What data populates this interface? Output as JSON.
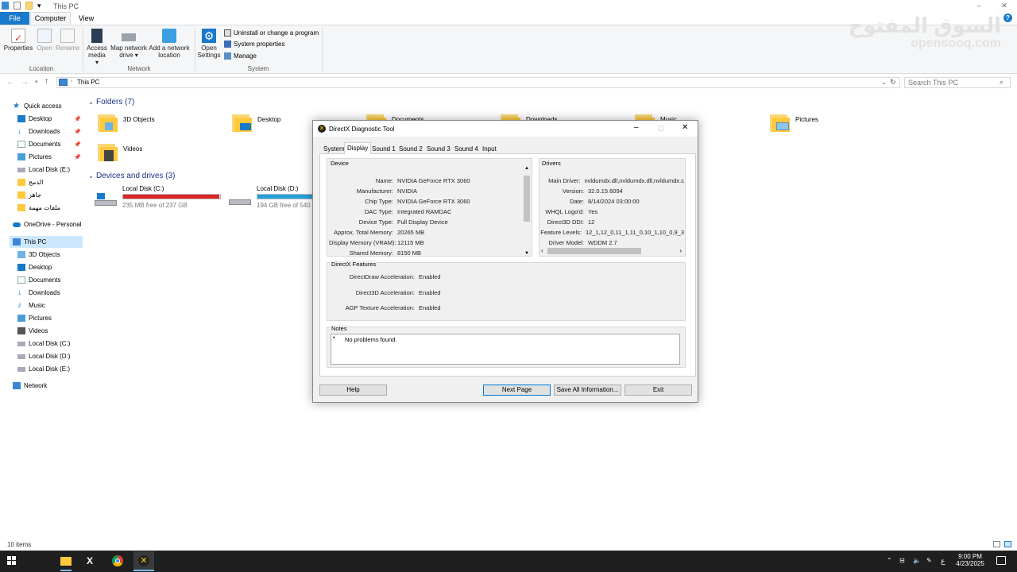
{
  "window": {
    "title": "This PC",
    "controls": [
      "–",
      "◻",
      "✕"
    ]
  },
  "ribbon_tabs": {
    "file": "File",
    "computer": "Computer",
    "view": "View"
  },
  "ribbon": {
    "location": {
      "group": "Location",
      "properties": "Properties",
      "open": "Open",
      "rename": "Rename"
    },
    "network": {
      "group": "Network",
      "access_media": "Access media",
      "access_media_2": "▾",
      "map_drive": "Map network",
      "map_drive_2": "drive ▾",
      "add_location": "Add a network",
      "add_location_2": "location"
    },
    "system": {
      "group": "System",
      "open_settings": "Open",
      "open_settings_2": "Settings",
      "uninstall": "Uninstall or change a program",
      "system_properties": "System properties",
      "manage": "Manage"
    }
  },
  "address": {
    "path": "This PC",
    "search_placeholder": "Search This PC"
  },
  "nav": {
    "quick_access": "Quick access",
    "qa_items": [
      "Desktop",
      "Downloads",
      "Documents",
      "Pictures",
      "Local Disk (E:)",
      "الدمج",
      "جاهز",
      "ملفات مهمة"
    ],
    "onedrive": "OneDrive - Personal",
    "this_pc": "This PC",
    "pc_items": [
      "3D Objects",
      "Desktop",
      "Documents",
      "Downloads",
      "Music",
      "Pictures",
      "Videos",
      "Local Disk (C:)",
      "Local Disk (D:)",
      "Local Disk (E:)"
    ],
    "network": "Network"
  },
  "folders": {
    "header": "Folders (7)",
    "items": [
      "3D Objects",
      "Desktop",
      "Documents",
      "Downloads",
      "Music",
      "Pictures",
      "Videos"
    ]
  },
  "drives": {
    "header": "Devices and drives (3)",
    "items": [
      {
        "name": "Local Disk (C:)",
        "free": "235 MB free of 237 GB",
        "used_fraction": 0.99
      },
      {
        "name": "Local Disk (D:)",
        "free": "194 GB free of 540 GB",
        "used_fraction": 0.64
      }
    ]
  },
  "status": {
    "items": "10 items"
  },
  "watermark": {
    "arabic": "السوق المفتوح",
    "latin": "opensooq.com"
  },
  "dxdiag": {
    "title": "DirectX Diagnostic Tool",
    "tabs": [
      "System",
      "Display",
      "Sound 1",
      "Sound 2",
      "Sound 3",
      "Sound 4",
      "Input"
    ],
    "device_label": "Device",
    "device": [
      {
        "k": "Name:",
        "v": "NVIDIA GeForce RTX 3060"
      },
      {
        "k": "Manufacturer:",
        "v": "NVIDIA"
      },
      {
        "k": "Chip Type:",
        "v": "NVIDIA GeForce RTX 3060"
      },
      {
        "k": "DAC Type:",
        "v": "Integrated RAMDAC"
      },
      {
        "k": "Device Type:",
        "v": "Full Display Device"
      },
      {
        "k": "Approx. Total Memory:",
        "v": "20265 MB"
      },
      {
        "k": "Display Memory (VRAM):",
        "v": "12115 MB"
      },
      {
        "k": "Shared Memory:",
        "v": "8150 MB"
      }
    ],
    "drivers_label": "Drivers",
    "drivers": [
      {
        "k": "Main Driver:",
        "v": "nvldumdx.dll,nvldumdx.dll,nvldumdx.c"
      },
      {
        "k": "Version:",
        "v": "32.0.15.6094"
      },
      {
        "k": "Date:",
        "v": "8/14/2024 03:00:00"
      },
      {
        "k": "WHQL Logo'd:",
        "v": "Yes"
      },
      {
        "k": "Direct3D DDI:",
        "v": "12"
      },
      {
        "k": "Feature Levels:",
        "v": "12_1,12_0,11_1,11_0,10_1,10_0,9_3"
      },
      {
        "k": "Driver Model:",
        "v": "WDDM 2.7"
      }
    ],
    "features_label": "DirectX Features",
    "features": [
      {
        "k": "DirectDraw Acceleration:",
        "v": "Enabled"
      },
      {
        "k": "Direct3D Acceleration:",
        "v": "Enabled"
      },
      {
        "k": "AGP Texture Acceleration:",
        "v": "Enabled"
      }
    ],
    "notes_label": "Notes",
    "notes": "No problems found.",
    "buttons": {
      "help": "Help",
      "next": "Next Page",
      "save": "Save All Information...",
      "exit": "Exit"
    }
  },
  "taskbar": {
    "time": "9:00 PM",
    "date": "4/23/2025",
    "lang": "ع"
  },
  "colors": {
    "accent": "#1979ca",
    "drive_full": "#da2626",
    "drive_normal": "#26a0da"
  }
}
